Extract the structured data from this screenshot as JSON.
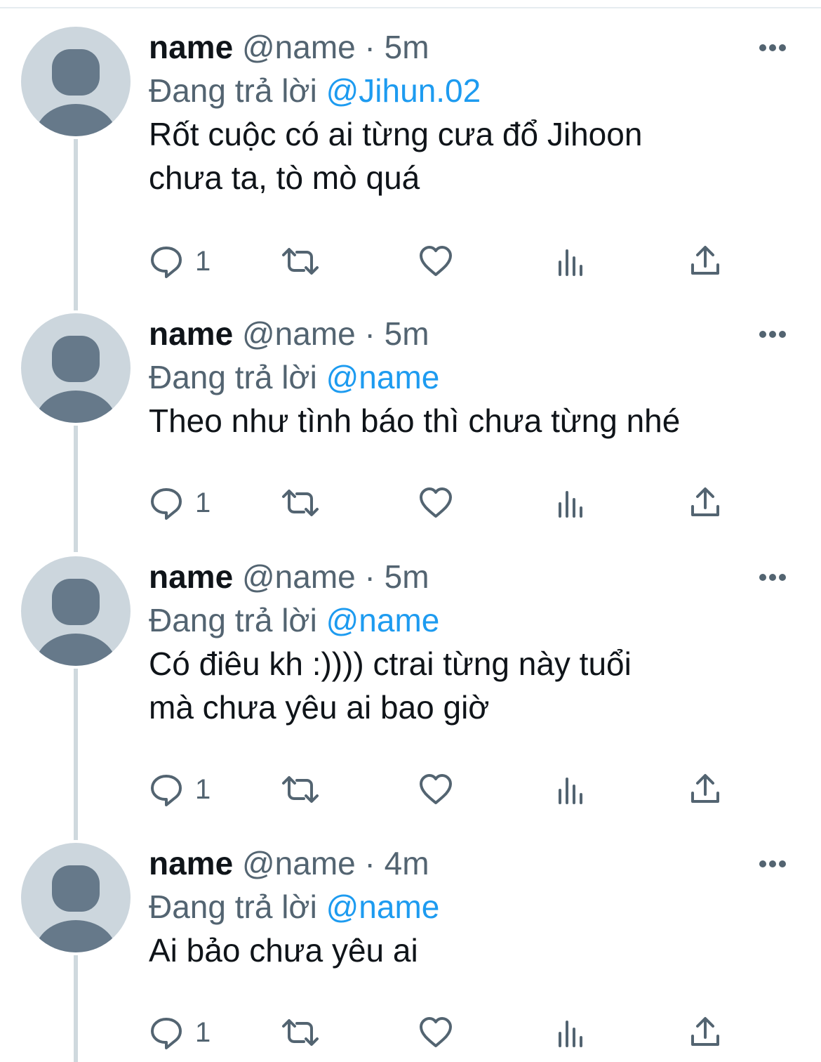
{
  "tweets": [
    {
      "name": "name",
      "handle": "@name",
      "sep": " · ",
      "time": "5m",
      "replying_prefix": "Đang trả lời ",
      "replying_to": "@Jihun.02",
      "text": "Rốt cuộc có ai từng cưa đổ Jihoon\nchưa ta, tò mò quá",
      "reply_count": "1"
    },
    {
      "name": "name",
      "handle": "@name",
      "sep": " · ",
      "time": "5m",
      "replying_prefix": "Đang trả lời ",
      "replying_to": "@name",
      "text": "Theo như tình báo thì chưa từng nhé",
      "reply_count": "1"
    },
    {
      "name": "name",
      "handle": "@name",
      "sep": " · ",
      "time": "5m",
      "replying_prefix": "Đang trả lời ",
      "replying_to": "@name",
      "text": "Có điêu kh :)))) ctrai từng này tuổi\nmà chưa yêu ai bao giờ",
      "reply_count": "1"
    },
    {
      "name": "name",
      "handle": "@name",
      "sep": " · ",
      "time": "4m",
      "replying_prefix": "Đang trả lời ",
      "replying_to": "@name",
      "text": "Ai bảo chưa yêu ai",
      "reply_count": "1"
    }
  ],
  "icons": {
    "reply": "reply-icon",
    "retweet": "retweet-icon",
    "like": "heart-icon",
    "views": "views-icon",
    "share": "share-icon",
    "more": "more-icon"
  },
  "colors": {
    "text": "#0f1419",
    "secondary": "#536471",
    "accent": "#1d9bf0",
    "avatar_bg": "#ccd6dd",
    "avatar_fg": "#66798a",
    "thread_line": "#cfd9de"
  }
}
